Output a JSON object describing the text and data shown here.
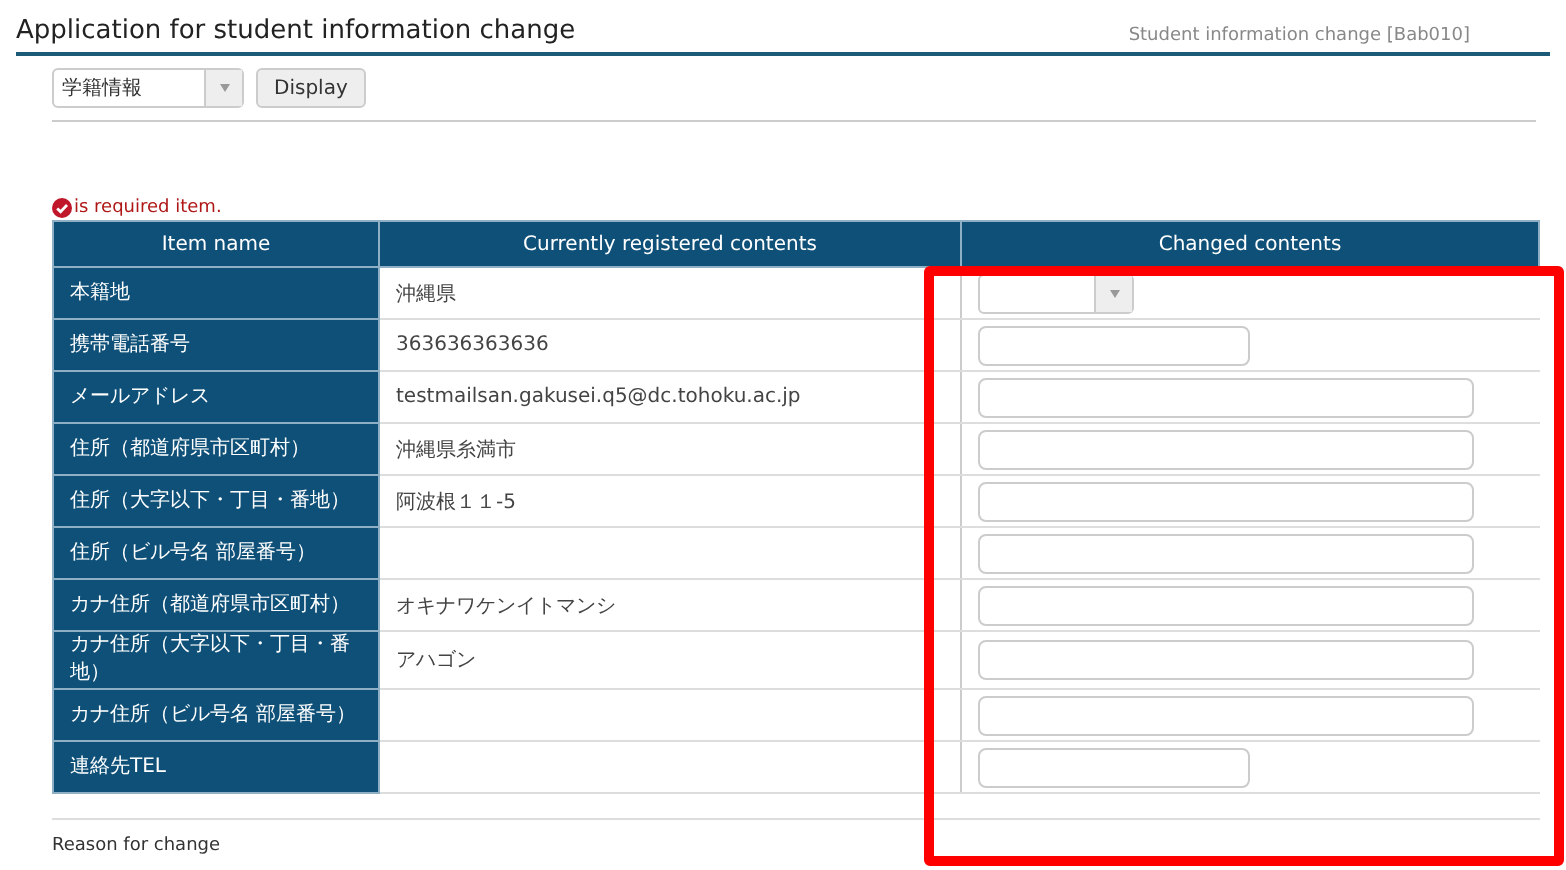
{
  "header": {
    "title": "Application for student information change",
    "screen_id": "Student information change [Bab010]"
  },
  "toolbar": {
    "category_select": {
      "value": "学籍情報"
    },
    "display_button": "Display"
  },
  "required_note": "is required item.",
  "table": {
    "columns": [
      "Item name",
      "Currently registered contents",
      "Changed contents"
    ],
    "rows": [
      {
        "item": "本籍地",
        "current": "沖縄県",
        "kind": "select"
      },
      {
        "item": "携帯電話番号",
        "current": "363636363636",
        "kind": "short"
      },
      {
        "item": "メールアドレス",
        "current": "testmailsan.gakusei.q5@dc.tohoku.ac.jp",
        "kind": "long"
      },
      {
        "item": "住所（都道府県市区町村）",
        "current": "沖縄県糸満市",
        "kind": "long"
      },
      {
        "item": "住所（大字以下・丁目・番地）",
        "current": "阿波根１１-5",
        "kind": "long"
      },
      {
        "item": "住所（ビル号名 部屋番号）",
        "kind": "long"
      },
      {
        "item": "カナ住所（都道府県市区町村）",
        "current": "オキナワケンイトマンシ",
        "kind": "long"
      },
      {
        "item": "カナ住所（大字以下・丁目・番地）",
        "current": "アハゴン",
        "kind": "long"
      },
      {
        "item": "カナ住所（ビル号名 部屋番号）",
        "kind": "long"
      },
      {
        "item": "連絡先TEL",
        "kind": "short"
      }
    ]
  },
  "reason_label": "Reason for change"
}
